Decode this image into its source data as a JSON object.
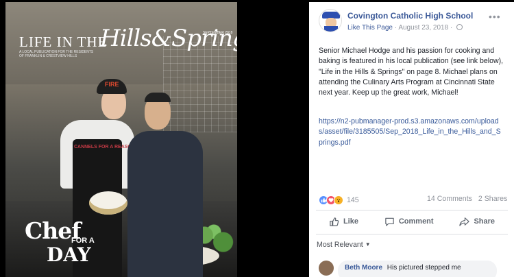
{
  "magazine": {
    "title_part1": "LIFE IN THE",
    "title_script": "Hills&Springs",
    "subtitle": "A LOCAL PUBLICATION FOR THE RESIDENTS OF FRANKLIN & CRESTVIEW HILLS",
    "issue_date": "SEPTEMBER 2018",
    "cap_logo": "FIRE",
    "shirt_text": "CANNELS FOR A REASON",
    "feature_line1": "Chef",
    "feature_line2": "FOR A",
    "feature_line3": "DAY"
  },
  "post": {
    "page_name": "Covington Catholic High School",
    "like_page": "Like This Page",
    "separator": "·",
    "date": "August 23, 2018",
    "body": "Senior Michael Hodge and his passion for cooking and baking is featured in his local publication (see link below), \"Life in the Hills & Springs\" on page 8. Michael plans on attending the Culinary Arts Program at Cincinnati State next year. Keep up the great work, Michael!",
    "link": "https://n2-pubmanager-prod.s3.amazonaws.com/uploads/asset/file/3185505/Sep_2018_Life_in_the_Hills_and_Springs.pdf",
    "reaction_count": "145",
    "comments": "14 Comments",
    "shares": "2 Shares",
    "actions": {
      "like": "Like",
      "comment": "Comment",
      "share": "Share"
    },
    "sort_label": "Most Relevant",
    "comment": {
      "author": "Beth Moore",
      "text": "His pictured stepped me"
    }
  },
  "colors": {
    "facebook_blue": "#3b5998",
    "link_blue": "#365899",
    "secondary_text": "#90949c",
    "like_reaction": "#5890ff",
    "love_reaction": "#f25268",
    "wow_reaction": "#f7b125"
  },
  "icons": [
    "more-icon",
    "globe-icon",
    "like-reaction-icon",
    "love-reaction-icon",
    "wow-reaction-icon",
    "thumbs-up-icon",
    "comment-icon",
    "share-icon",
    "caret-down-icon"
  ]
}
